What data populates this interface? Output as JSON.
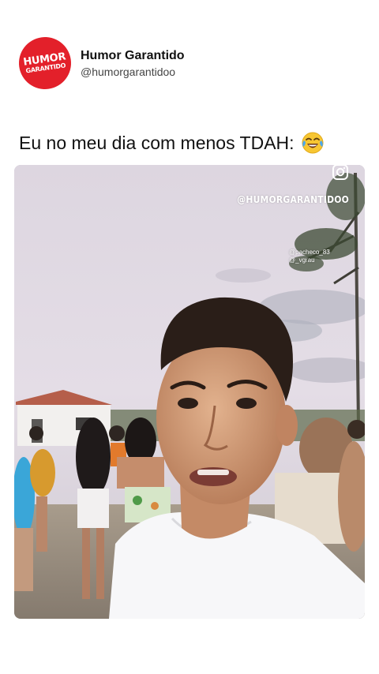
{
  "post": {
    "avatar_text": [
      "HUMOR",
      "GARANTIDO"
    ],
    "display_name": "Humor Garantido",
    "handle": "@humorgarantidoo",
    "caption": "Eu no meu dia com menos TDAH:",
    "caption_emoji": "face-with-tears-of-joy"
  },
  "media": {
    "watermark": "@HUMORGARANTIDOO",
    "credits": [
      "@pacheco_83",
      "@_vgrau"
    ],
    "overlay_icon": "instagram-icon"
  },
  "colors": {
    "brand_red": "#e3202a",
    "text_primary": "#111111",
    "text_secondary": "#444444",
    "background": "#ffffff"
  }
}
